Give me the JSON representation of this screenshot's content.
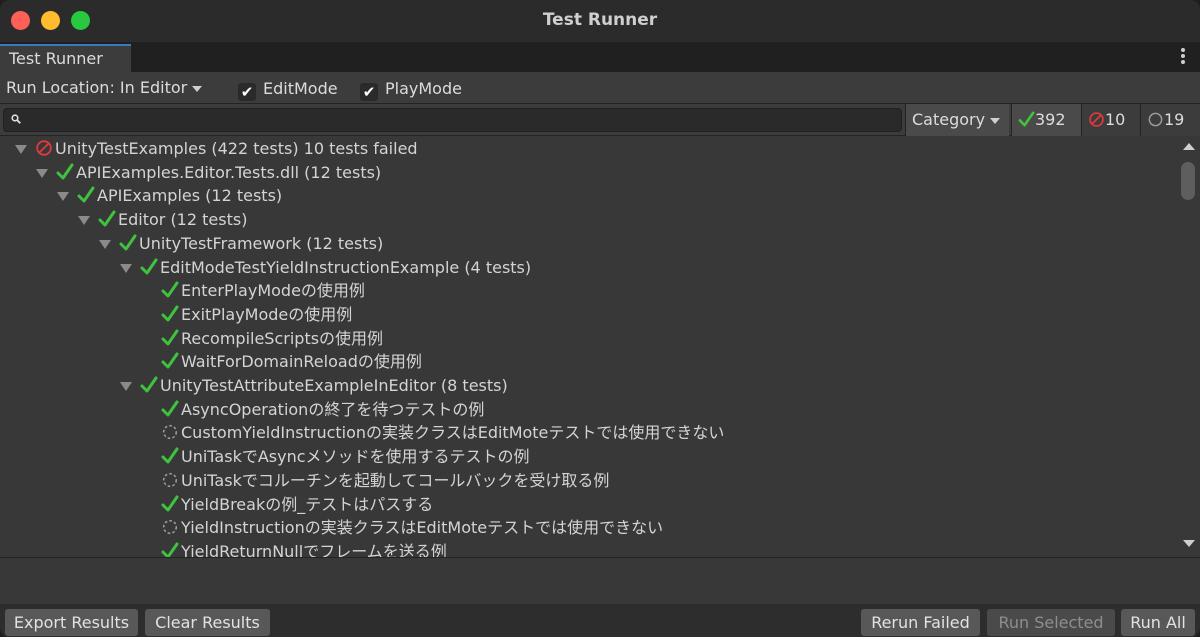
{
  "window": {
    "title": "Test Runner"
  },
  "tab": {
    "label": "Test Runner"
  },
  "toolbar": {
    "run_location": "Run Location: In Editor",
    "editmode_label": "EditMode",
    "playmode_label": "PlayMode"
  },
  "filters": {
    "category_label": "Category",
    "passed": "392",
    "failed": "10",
    "skipped": "19"
  },
  "colors": {
    "pass": "#3fc33f",
    "fail": "#e03a3a",
    "pending": "#9a9a9a"
  },
  "tree": [
    {
      "label": "UnityTestExamples (422 tests)  10 tests failed",
      "status": "fail",
      "foldout": true,
      "depth": 0
    },
    {
      "label": "APIExamples.Editor.Tests.dll (12 tests)",
      "status": "pass",
      "foldout": true,
      "depth": 1
    },
    {
      "label": "APIExamples (12 tests)",
      "status": "pass",
      "foldout": true,
      "depth": 2
    },
    {
      "label": "Editor (12 tests)",
      "status": "pass",
      "foldout": true,
      "depth": 3
    },
    {
      "label": "UnityTestFramework (12 tests)",
      "status": "pass",
      "foldout": true,
      "depth": 4
    },
    {
      "label": "EditModeTestYieldInstructionExample (4 tests)",
      "status": "pass",
      "foldout": true,
      "depth": 5
    },
    {
      "label": "EnterPlayModeの使用例",
      "status": "pass",
      "foldout": false,
      "depth": 6
    },
    {
      "label": "ExitPlayModeの使用例",
      "status": "pass",
      "foldout": false,
      "depth": 6
    },
    {
      "label": "RecompileScriptsの使用例",
      "status": "pass",
      "foldout": false,
      "depth": 6
    },
    {
      "label": "WaitForDomainReloadの使用例",
      "status": "pass",
      "foldout": false,
      "depth": 6
    },
    {
      "label": "UnityTestAttributeExampleInEditor (8 tests)",
      "status": "pass",
      "foldout": true,
      "depth": 5
    },
    {
      "label": "AsyncOperationの終了を待つテストの例",
      "status": "pass",
      "foldout": false,
      "depth": 6
    },
    {
      "label": "CustomYieldInstructionの実装クラスはEditMoteテストでは使用できない",
      "status": "pending",
      "foldout": false,
      "depth": 6
    },
    {
      "label": "UniTaskでAsyncメソッドを使用するテストの例",
      "status": "pass",
      "foldout": false,
      "depth": 6
    },
    {
      "label": "UniTaskでコルーチンを起動してコールバックを受け取る例",
      "status": "pending",
      "foldout": false,
      "depth": 6
    },
    {
      "label": "YieldBreakの例_テストはパスする",
      "status": "pass",
      "foldout": false,
      "depth": 6
    },
    {
      "label": "YieldInstructionの実装クラスはEditMoteテストでは使用できない",
      "status": "pending",
      "foldout": false,
      "depth": 6
    },
    {
      "label": "YieldReturnNullでフレームを送る例",
      "status": "pass",
      "foldout": false,
      "depth": 6
    }
  ],
  "buttons": {
    "export": "Export Results",
    "clear": "Clear Results",
    "rerun_failed": "Rerun Failed",
    "run_selected": "Run Selected",
    "run_all": "Run All"
  }
}
